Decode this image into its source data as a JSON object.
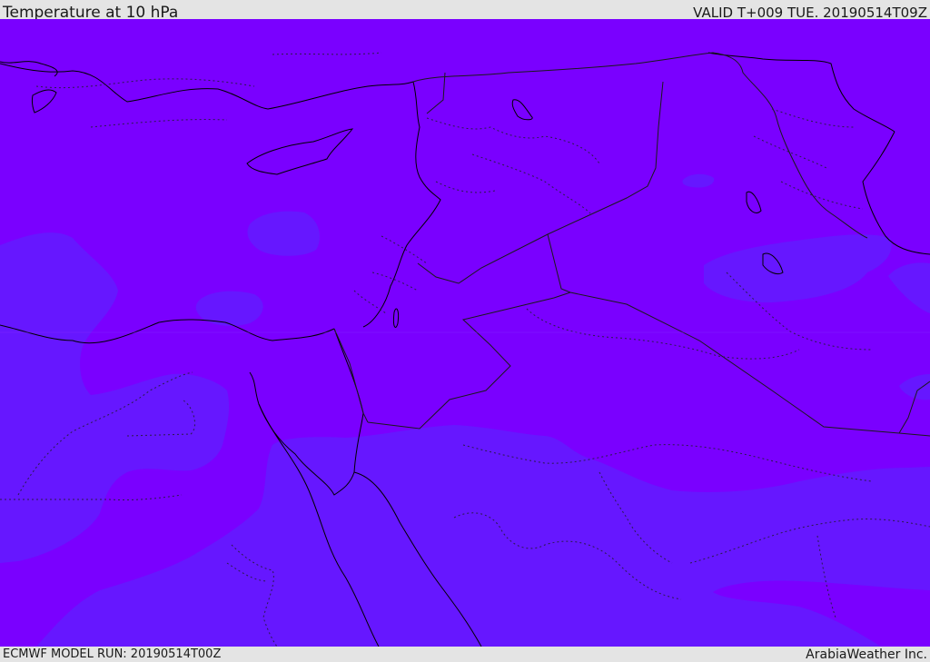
{
  "header": {
    "title": "Temperature at 10 hPa",
    "valid_time": "VALID T+009 TUE. 20190514T09Z"
  },
  "footer": {
    "model_run": "ECMWF MODEL RUN: 20190514T00Z",
    "credit": "ArabiaWeather Inc."
  },
  "map": {
    "field": "temperature",
    "colors": {
      "warm_band": "#7a00ff",
      "cool_band": "#6617ff",
      "coastline": "#000000",
      "border": "#1a1a1a"
    }
  }
}
